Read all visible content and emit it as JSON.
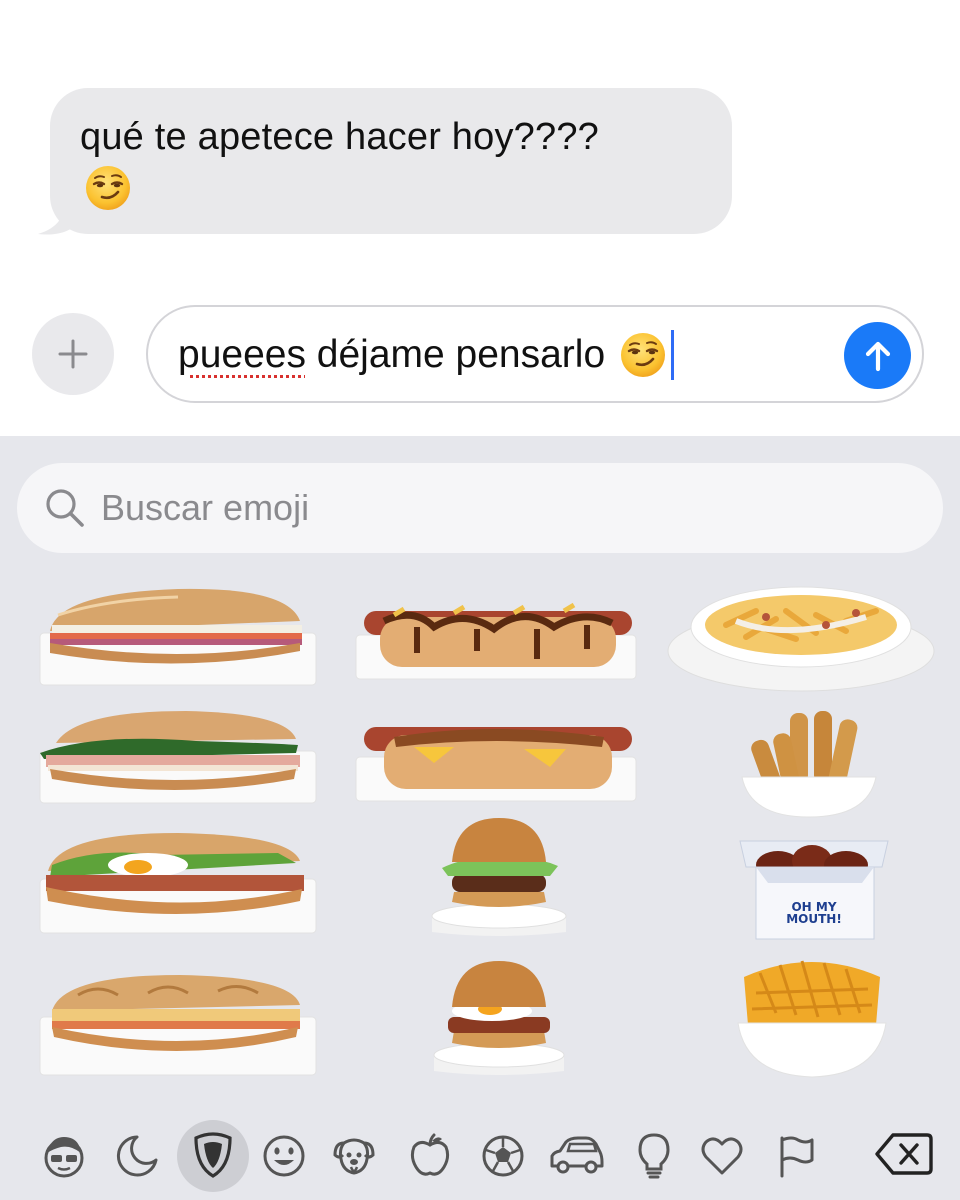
{
  "conversation": {
    "incoming_message": {
      "text": "qué te apetece hacer hoy????",
      "emoji": "smirking-face"
    }
  },
  "composer": {
    "plus_button": "plus-icon",
    "draft_word_misspelled": "pueees",
    "draft_text_rest": "déjame pensarlo",
    "draft_emoji": "smirking-face",
    "send_button": "arrow-up-icon"
  },
  "emoji_keyboard": {
    "search": {
      "placeholder": "Buscar emoji"
    },
    "stickers": [
      {
        "name": "sandwich-cheese-tomato",
        "kind": "baguette"
      },
      {
        "name": "hotdog-caramelized-onion",
        "kind": "hotdog"
      },
      {
        "name": "loaded-fries-bowl",
        "kind": "fries-plate"
      },
      {
        "name": "sandwich-ham-spinach",
        "kind": "baguette"
      },
      {
        "name": "hotdog-cheese-crispy-onion",
        "kind": "hotdog"
      },
      {
        "name": "cheese-sticks-bowl",
        "kind": "sticks"
      },
      {
        "name": "sandwich-egg-bacon",
        "kind": "baguette"
      },
      {
        "name": "burger-lettuce",
        "kind": "burger"
      },
      {
        "name": "chicken-wings-box",
        "kind": "wings"
      },
      {
        "name": "sandwich-toasted",
        "kind": "baguette"
      },
      {
        "name": "burger-egg-bacon",
        "kind": "burger"
      },
      {
        "name": "waffle-fries-bowl",
        "kind": "waffle-fries"
      }
    ],
    "wings_box_label": "OH MY MOUTH!",
    "categories": [
      {
        "name": "memoji-icon",
        "active": false
      },
      {
        "name": "recent-icon",
        "active": false
      },
      {
        "name": "stickers-icon",
        "active": true
      },
      {
        "name": "smileys-icon",
        "active": false
      },
      {
        "name": "animals-icon",
        "active": false
      },
      {
        "name": "food-icon",
        "active": false
      },
      {
        "name": "activity-icon",
        "active": false
      },
      {
        "name": "travel-icon",
        "active": false
      },
      {
        "name": "objects-icon",
        "active": false
      },
      {
        "name": "symbols-icon",
        "active": false
      },
      {
        "name": "flags-icon",
        "active": false
      }
    ],
    "delete_key": "delete-icon"
  },
  "colors": {
    "bubble": "#e9e9eb",
    "send": "#1a7af8",
    "keyboard_bg": "#e6e7ec",
    "caret": "#2e6cf6",
    "spellcheck": "#d8312e"
  }
}
